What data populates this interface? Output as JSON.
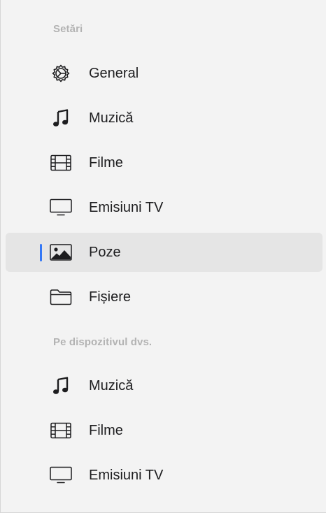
{
  "sidebar": {
    "section_settings": {
      "title": "Setări",
      "items": [
        {
          "label": "General",
          "icon": "gear-icon"
        },
        {
          "label": "Muzică",
          "icon": "music-note-icon"
        },
        {
          "label": "Filme",
          "icon": "film-icon"
        },
        {
          "label": "Emisiuni TV",
          "icon": "tv-icon"
        },
        {
          "label": "Poze",
          "icon": "photo-icon",
          "selected": true
        },
        {
          "label": "Fișiere",
          "icon": "folder-icon"
        }
      ]
    },
    "section_device": {
      "title": "Pe dispozitivul dvs.",
      "items": [
        {
          "label": "Muzică",
          "icon": "music-note-icon"
        },
        {
          "label": "Filme",
          "icon": "film-icon"
        },
        {
          "label": "Emisiuni TV",
          "icon": "tv-icon"
        }
      ]
    }
  },
  "colors": {
    "accent": "#3478f6",
    "selected_background": "#e5e5e5",
    "section_title": "#b3b3b3",
    "text": "#1d1d1f"
  }
}
